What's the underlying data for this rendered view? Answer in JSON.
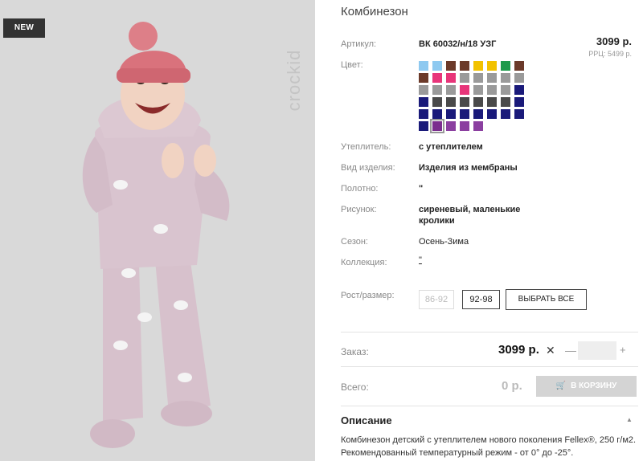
{
  "badge": "NEW",
  "watermark": "crockid",
  "product": {
    "title": "Комбинезон",
    "price": "3099 р.",
    "rrp": "РРЦ: 5499 р.",
    "specs": {
      "article_label": "Артикул:",
      "article_value": "ВК 60032/н/18 УЗГ",
      "color_label": "Цвет:",
      "insulation_label": "Утеплитель:",
      "insulation_value": "с утеплителем",
      "type_label": "Вид изделия:",
      "type_value": "Изделия из мембраны",
      "fabric_label": "Полотно:",
      "fabric_value": "\"",
      "pattern_label": "Рисунок:",
      "pattern_value_1": "сиреневый, маленькие",
      "pattern_value_2": "кролики",
      "season_label": "Сезон:",
      "season_value": "Осень-Зима",
      "collection_label": "Коллекция:",
      "collection_value": "\"",
      "size_label": "Рост/размер:"
    },
    "colors": [
      [
        "#8ec9f0",
        "#8ec9f0",
        "#6b3a2a",
        "#6b3a2a",
        "#f2c200",
        "#f2c200",
        "#1e9a4b",
        "#6b3a2a"
      ],
      [
        "#6b3a2a",
        "#e8357a",
        "#e8357a",
        "#9a9a9a",
        "#9a9a9a",
        "#9a9a9a",
        "#9a9a9a",
        "#9a9a9a"
      ],
      [
        "#9a9a9a",
        "#9a9a9a",
        "#9a9a9a",
        "#e8357a",
        "#9a9a9a",
        "#9a9a9a",
        "#9a9a9a",
        "#1a1a7a"
      ],
      [
        "#1a1a7a",
        "#4a4a4a",
        "#4a4a4a",
        "#4a4a4a",
        "#4a4a4a",
        "#4a4a4a",
        "#4a4a4a",
        "#1a1a7a"
      ],
      [
        "#1a1a7a",
        "#1a1a7a",
        "#1a1a7a",
        "#1a1a7a",
        "#1a1a7a",
        "#1a1a7a",
        "#1a1a7a",
        "#1a1a7a"
      ],
      [
        "#1a1a7a",
        "#7b2d8e",
        "#8b3fa0",
        "#8b3fa0",
        "#8b3fa0"
      ]
    ],
    "selected_color_index": [
      5,
      1
    ],
    "sizes": [
      {
        "label": "86-92",
        "disabled": true
      },
      {
        "label": "92-98",
        "disabled": false
      }
    ],
    "select_all": "ВЫБРАТЬ ВСЕ"
  },
  "order": {
    "order_label": "Заказ:",
    "order_price": "3099 р.",
    "times": "✕",
    "minus": "—",
    "plus": "+",
    "quantity": "",
    "total_label": "Всего:",
    "total_value": "0 р.",
    "cart_button": "В КОРЗИНУ"
  },
  "description": {
    "heading": "Описание",
    "text": "Комбинезон детский с утеплителем нового поколения Fellex®, 250 г/м2. Рекомендованный температурный режим - от 0° до -25°."
  }
}
